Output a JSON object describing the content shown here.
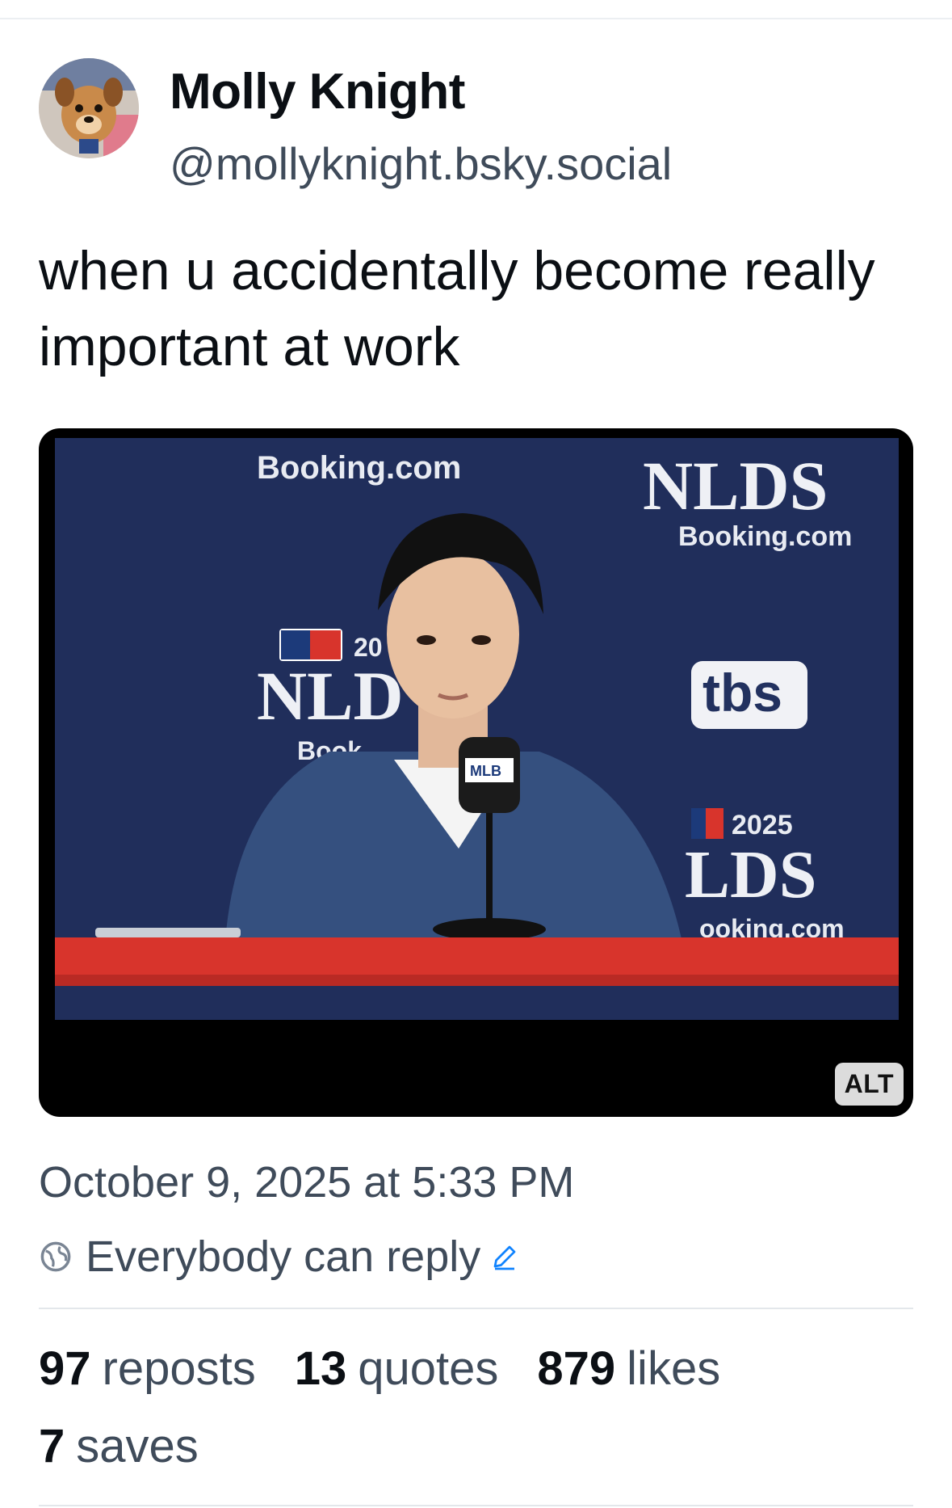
{
  "author": {
    "display_name": "Molly Knight",
    "handle": "@mollyknight.bsky.social",
    "avatar_icon": "dog-avatar"
  },
  "post": {
    "text": "when u accidentally become really important at work",
    "image": {
      "alt_badge": "ALT",
      "backdrop_text": {
        "booking_top": "Booking.com",
        "nlds_right": "NLDS",
        "booking_right": "Booking.com",
        "nld_left": "NLD",
        "booking_left_partial": "Book",
        "year_left_partial": "20",
        "tbs": "tbs",
        "year_right": "2025",
        "lds_bottom": "LDS",
        "booking_bottom_partial": "ooking.com",
        "mic_flag": "MLB"
      }
    },
    "timestamp": "October 9, 2025 at 5:33 PM",
    "reply_setting": "Everybody can reply"
  },
  "stats": {
    "reposts": {
      "count": "97",
      "label": "reposts"
    },
    "quotes": {
      "count": "13",
      "label": "quotes"
    },
    "likes": {
      "count": "879",
      "label": "likes"
    },
    "saves": {
      "count": "7",
      "label": "saves"
    }
  },
  "colors": {
    "text_primary": "#0b0f14",
    "text_secondary": "#3f4b5a",
    "backdrop_navy": "#22315f",
    "table_red": "#d8342c",
    "link_blue": "#1083fe"
  }
}
